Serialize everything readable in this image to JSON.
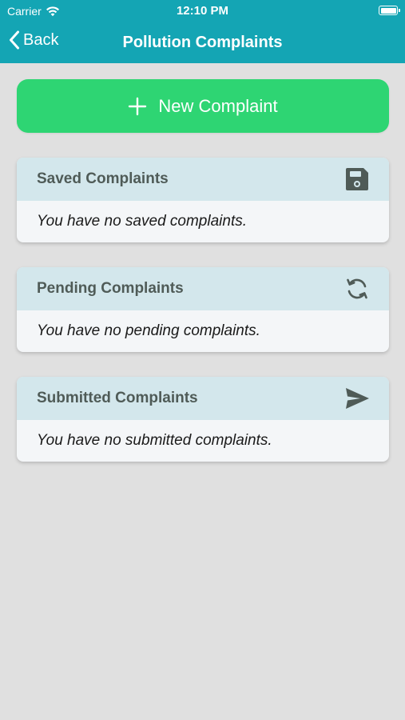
{
  "status_bar": {
    "carrier": "Carrier",
    "time": "12:10 PM"
  },
  "nav": {
    "back_label": "Back",
    "title": "Pollution Complaints"
  },
  "actions": {
    "new_complaint_label": "New Complaint"
  },
  "sections": [
    {
      "title": "Saved Complaints",
      "icon": "floppy-disk-icon",
      "empty_message": "You have no saved complaints."
    },
    {
      "title": "Pending Complaints",
      "icon": "sync-icon",
      "empty_message": "You have no pending complaints."
    },
    {
      "title": "Submitted Complaints",
      "icon": "send-icon",
      "empty_message": "You have no submitted complaints."
    }
  ],
  "colors": {
    "header": "#14a5b4",
    "primary_button": "#2ed573",
    "card_header": "#d3e7ec",
    "card_body": "#f4f6f8",
    "background": "#e0e0e0"
  }
}
